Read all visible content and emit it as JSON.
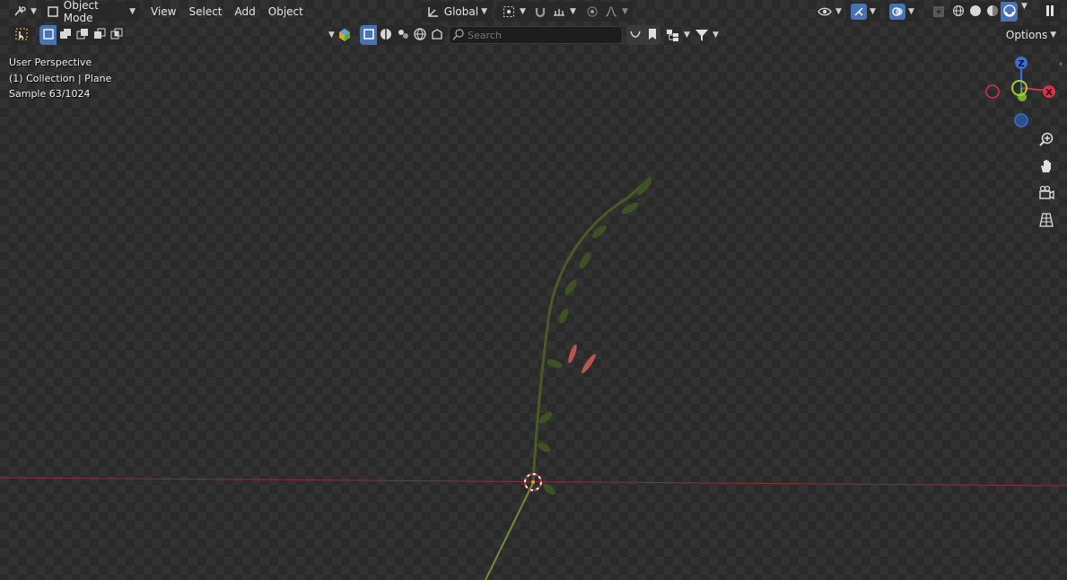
{
  "header": {
    "editor_type_icon": "editor-type-icon",
    "mode_label": "Object Mode",
    "menus": [
      "View",
      "Select",
      "Add",
      "Object"
    ],
    "transform_orientation": "Global",
    "options_label": "Options",
    "search_placeholder": "Search"
  },
  "overlay": {
    "perspective": "User Perspective",
    "collection": "(1) Collection | Plane",
    "sample": "Sample 63/1024"
  },
  "gizmo": {
    "x_label": "X",
    "y_label": "",
    "z_label": "Z",
    "x_color": "#d4334a",
    "y_color": "#7aad24",
    "z_color": "#3b6fd1"
  },
  "colors": {
    "accent": "#4772b3",
    "x_axis_line": "#8c2f3a"
  }
}
